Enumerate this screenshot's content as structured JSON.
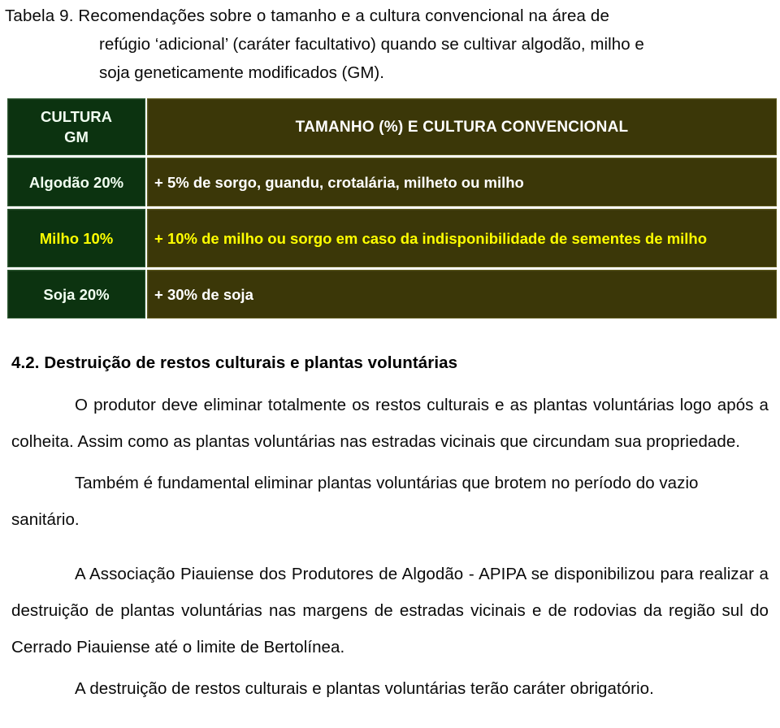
{
  "caption": {
    "line1": "Tabela 9. Recomendações sobre o tamanho e a cultura convencional na área de",
    "line2": "refúgio ‘adicional’ (caráter facultativo) quando se cultivar algodão, milho e",
    "line3": "soja geneticamente modificados (GM)."
  },
  "table": {
    "colors": {
      "left_cell_bg": "#0c3310",
      "right_cell_bg": "#3b3708",
      "left_text": "#f2fff2",
      "right_text": "#ffffff",
      "highlight_text": "#ffff00",
      "page_bg": "#ffffff"
    },
    "headers": {
      "col1_line1": "CULTURA",
      "col1_line2": "GM",
      "col2": "TAMANHO (%) E CULTURA CONVENCIONAL"
    },
    "rows": [
      {
        "culture": "Algodão 20%",
        "recommendation": "+ 5% de sorgo, guandu, crotalária, milheto ou milho",
        "highlighted": false
      },
      {
        "culture": "Milho 10%",
        "recommendation": "+ 10% de milho ou sorgo em caso da indisponibilidade de sementes de milho",
        "highlighted": true
      },
      {
        "culture": "Soja 20%",
        "recommendation": "+ 30% de soja",
        "highlighted": false
      }
    ]
  },
  "section": {
    "heading": "4.2. Destruição de restos culturais e plantas voluntárias",
    "paragraphs": [
      "O produtor deve eliminar totalmente os restos culturais e as plantas voluntárias logo após a colheita. Assim como as plantas voluntárias nas estradas vicinais que circundam sua propriedade.",
      "Também é fundamental eliminar plantas voluntárias que brotem no período do vazio sanitário.",
      "A Associação Piauiense dos Produtores de Algodão - APIPA se disponibilizou para realizar a destruição de plantas voluntárias nas margens de estradas vicinais e de rodovias da região sul do Cerrado Piauiense até o limite de Bertolínea.",
      "A destruição de restos culturais e plantas voluntárias terão caráter obrigatório."
    ]
  }
}
